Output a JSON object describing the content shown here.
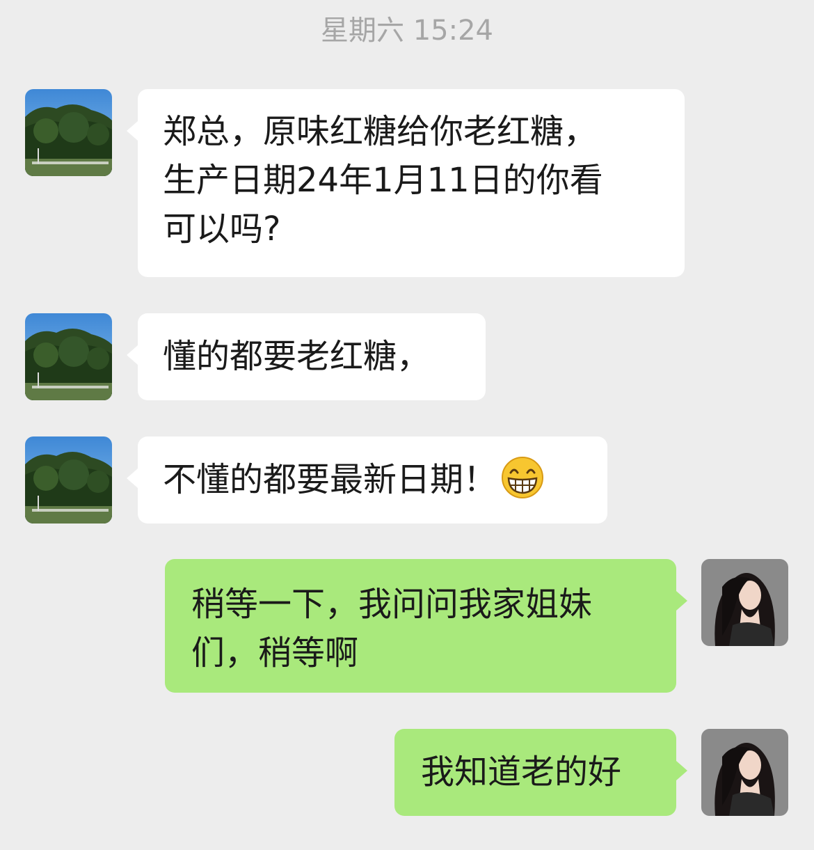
{
  "chat": {
    "timestamp": "星期六 15:24",
    "messages": [
      {
        "direction": "incoming",
        "avatar": "landscape-avatar",
        "text_lines": [
          "郑总，原味红糖给你老红糖，",
          "生产日期24年1月11日的你看",
          "可以吗?"
        ]
      },
      {
        "direction": "incoming",
        "avatar": "landscape-avatar",
        "text": "懂的都要老红糖，"
      },
      {
        "direction": "incoming",
        "avatar": "landscape-avatar",
        "text": "不懂的都要最新日期！",
        "emoji": "grinning-face-emoji"
      },
      {
        "direction": "outgoing",
        "avatar": "woman-portrait-avatar",
        "text_lines": [
          "稍等一下，我问问我家姐妹",
          "们，稍等啊"
        ]
      },
      {
        "direction": "outgoing",
        "avatar": "woman-portrait-avatar",
        "text": "我知道老的好"
      }
    ]
  },
  "colors": {
    "background": "#ededed",
    "incoming_bubble": "#ffffff",
    "outgoing_bubble": "#a9e97c",
    "timestamp": "#a6a6a6"
  }
}
